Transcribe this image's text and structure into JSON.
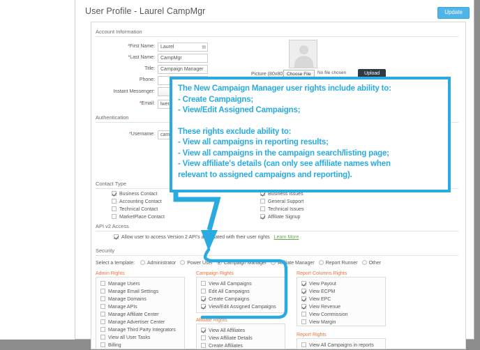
{
  "window": {
    "page_title": "User Profile - Laurel CampMgr",
    "update_button": "Update",
    "accent_blue": "#4fb4e8",
    "annotation_blue": "#29abe2",
    "section_orange": "#e8743b"
  },
  "sections": {
    "account_information": "Account Information",
    "authentication": "Authentication",
    "contact_type": "Contact Type",
    "api_v2_access": "API v2 Access",
    "security": "Security"
  },
  "account_fields": {
    "first_name_label": "First Name:",
    "first_name_value": "Laurel",
    "last_name_label": "Last Name:",
    "last_name_value": "CampMgr",
    "title_label": "Title:",
    "title_value": "Campaign Manager",
    "phone_label": "Phone:",
    "phone_value": "",
    "instant_messenger_label": "Instant Messenger:",
    "instant_messenger_value": "",
    "im_handle_value": "",
    "email_label": "Email:",
    "email_value": "lwendt@linktrust"
  },
  "picture": {
    "label": "Picture (80x80):",
    "choose_file_button": "Choose File",
    "no_file_text": "No file chosen",
    "upload_button": "Upload",
    "avatar_icon": "user-avatar-placeholder-icon"
  },
  "authentication": {
    "username_label": "Username:",
    "username_value": "campmgr"
  },
  "contact_type_left": [
    {
      "label": "Business Contact",
      "checked": true
    },
    {
      "label": "Accounting Contact",
      "checked": false
    },
    {
      "label": "Technical Contact",
      "checked": false
    },
    {
      "label": "MarketPlace Contact",
      "checked": false
    }
  ],
  "contact_type_right": [
    {
      "label": "Business Issues",
      "checked": true
    },
    {
      "label": "General Support",
      "checked": false
    },
    {
      "label": "Technical Issues",
      "checked": false
    },
    {
      "label": "Affiliate Signup",
      "checked": true
    }
  ],
  "api_v2": {
    "checkbox_label": "Allow user to access Version 2 API's associated with their user rights",
    "checked": true,
    "learn_more": "Learn More"
  },
  "security": {
    "select_template_label": "Select a template:",
    "templates": [
      {
        "label": "Administrator",
        "selected": false
      },
      {
        "label": "Power User",
        "selected": false
      },
      {
        "label": "Campaign Manager",
        "selected": true
      },
      {
        "label": "Affiliate Manager",
        "selected": false
      },
      {
        "label": "Report Runner",
        "selected": false
      },
      {
        "label": "Other",
        "selected": false
      }
    ]
  },
  "rights_panels": {
    "admin_rights": {
      "title": "Admin Rights",
      "items": [
        {
          "label": "Manage Users",
          "checked": false
        },
        {
          "label": "Manage Email Settings",
          "checked": false
        },
        {
          "label": "Manage Domains",
          "checked": false
        },
        {
          "label": "Manage APIs",
          "checked": false
        },
        {
          "label": "Manage Affiliate Center",
          "checked": false
        },
        {
          "label": "Manage Advertiser Center",
          "checked": false
        },
        {
          "label": "Manage Third Party Integrators",
          "checked": false
        },
        {
          "label": "View all User Tasks",
          "checked": false
        },
        {
          "label": "Billing",
          "checked": false
        }
      ]
    },
    "campaign_rights": {
      "title": "Campaign Rights",
      "items": [
        {
          "label": "View All Campaigns",
          "checked": false
        },
        {
          "label": "Edit All Campaigns",
          "checked": false
        },
        {
          "label": "Create Campaigns",
          "checked": true
        },
        {
          "label": "View/Edit Assigned Campaigns",
          "checked": true
        }
      ]
    },
    "affiliate_rights": {
      "title": "Affiliate Rights",
      "items": [
        {
          "label": "View All Affiliates",
          "checked": true
        },
        {
          "label": "View Affiliate Details",
          "checked": false
        },
        {
          "label": "Create Affiliates",
          "checked": false
        }
      ]
    },
    "report_columns_rights": {
      "title": "Report Columns Rights",
      "items": [
        {
          "label": "View Payout",
          "checked": true
        },
        {
          "label": "View ECPM",
          "checked": true
        },
        {
          "label": "View EPC",
          "checked": true
        },
        {
          "label": "View Revenue",
          "checked": true
        },
        {
          "label": "View Commission",
          "checked": false
        },
        {
          "label": "View Margin",
          "checked": false
        }
      ]
    },
    "report_rights": {
      "title": "Report Rights",
      "items": [
        {
          "label": "View All Campaigns in reports",
          "checked": false
        }
      ]
    }
  },
  "annotation": {
    "line1": "The New Campaign Manager user rights include ability to:",
    "line2": "- Create Campaigns;",
    "line3": "- View/Edit Assigned Campaigns;",
    "line4": "These rights exclude ability to:",
    "line5": "- View all campaigns in reporting results;",
    "line6": "- View all campaigns in the campaign search/listing page;",
    "line7": "- View affiliate's details (can only see affiliate names when",
    "line8": "relevant to assigned campaigns and reporting)."
  }
}
